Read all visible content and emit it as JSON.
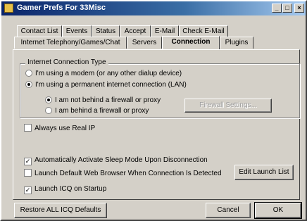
{
  "window": {
    "title": "Gamer Prefs For 33Misc",
    "controls": {
      "minimize": "_",
      "maximize": "□",
      "close": "×"
    }
  },
  "tabs": {
    "row1": [
      "Contact List",
      "Events",
      "Status",
      "Accept",
      "E-Mail",
      "Check E-Mail"
    ],
    "row2": [
      "Internet Telephony/Games/Chat",
      "Servers",
      "Connection",
      "Plugins"
    ],
    "active": "Connection"
  },
  "connection_type": {
    "legend": "Internet Connection Type",
    "modem_label": "I'm using a modem (or any other dialup device)",
    "lan_label": "I'm using a permanent internet connection (LAN)",
    "selected": "lan",
    "firewall": {
      "not_behind_label": "I am not behind a firewall or proxy",
      "behind_label": "I am behind a firewall or proxy",
      "selected": "not_behind",
      "settings_button": "Firewall Settings..."
    }
  },
  "options": {
    "always_real_ip": {
      "label": "Always use Real IP",
      "checked": false
    },
    "auto_sleep": {
      "label": "Automatically Activate Sleep Mode Upon Disconnection",
      "checked": true
    },
    "launch_browser": {
      "label": "Launch Default Web Browser When Connection Is Detected",
      "checked": false
    },
    "launch_startup": {
      "label": "Launch ICQ on Startup",
      "checked": true
    }
  },
  "buttons": {
    "edit_launch_list": "Edit Launch List",
    "restore_defaults": "Restore ALL ICQ Defaults",
    "cancel": "Cancel",
    "ok": "OK"
  },
  "colors": {
    "title_start": "#0a246a",
    "title_end": "#a6caf0",
    "face": "#d4d0c8"
  }
}
